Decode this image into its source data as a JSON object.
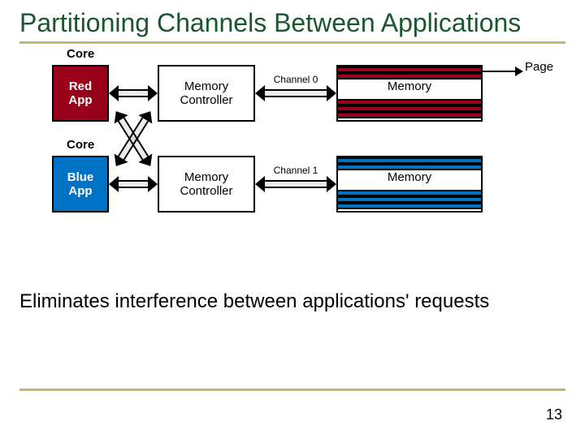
{
  "title": "Partitioning Channels Between Applications",
  "core_label": "Core",
  "red_app": "Red\nApp",
  "blue_app": "Blue\nApp",
  "mc_label": "Memory\nController",
  "mem_label": "Memory",
  "channel0": "Channel 0",
  "channel1": "Channel 1",
  "page_label": "Page",
  "body": "Eliminates interference between applications' requests",
  "page_num": "13",
  "colors": {
    "red": "#99001a",
    "blue": "#0072c6"
  }
}
